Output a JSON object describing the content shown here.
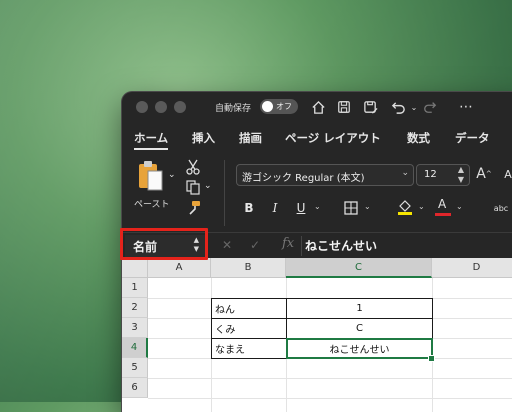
{
  "titlebar": {
    "autosave_label": "自動保存",
    "autosave_state": "オフ"
  },
  "tabs": [
    "ホーム",
    "挿入",
    "描画",
    "ページ レイアウト",
    "数式",
    "データ"
  ],
  "ribbon": {
    "paste_label": "ペースト",
    "font_name": "游ゴシック Regular (本文)",
    "font_size": "12",
    "bold": "B",
    "italic": "I",
    "underline": "U",
    "font_color_glyph": "A",
    "text_abc": "abc"
  },
  "formula_bar": {
    "name_box_value": "名前",
    "fx_label": "fx",
    "content": "ねこせんせい"
  },
  "grid": {
    "columns": [
      "A",
      "B",
      "C",
      "D"
    ],
    "rows": [
      "1",
      "2",
      "3",
      "4",
      "5",
      "6"
    ],
    "cells": [
      {
        "ref": "B2",
        "value": "ねん"
      },
      {
        "ref": "C2",
        "value": "1"
      },
      {
        "ref": "B3",
        "value": "くみ"
      },
      {
        "ref": "C3",
        "value": "C"
      },
      {
        "ref": "B4",
        "value": "なまえ"
      },
      {
        "ref": "C4",
        "value": "ねこせんせい"
      }
    ],
    "active_cell": "C4"
  },
  "colors": {
    "highlight": "#e5231b",
    "selection": "#1f7a43",
    "fill_yellow": "#f5e400",
    "font_red": "#e0262b"
  }
}
